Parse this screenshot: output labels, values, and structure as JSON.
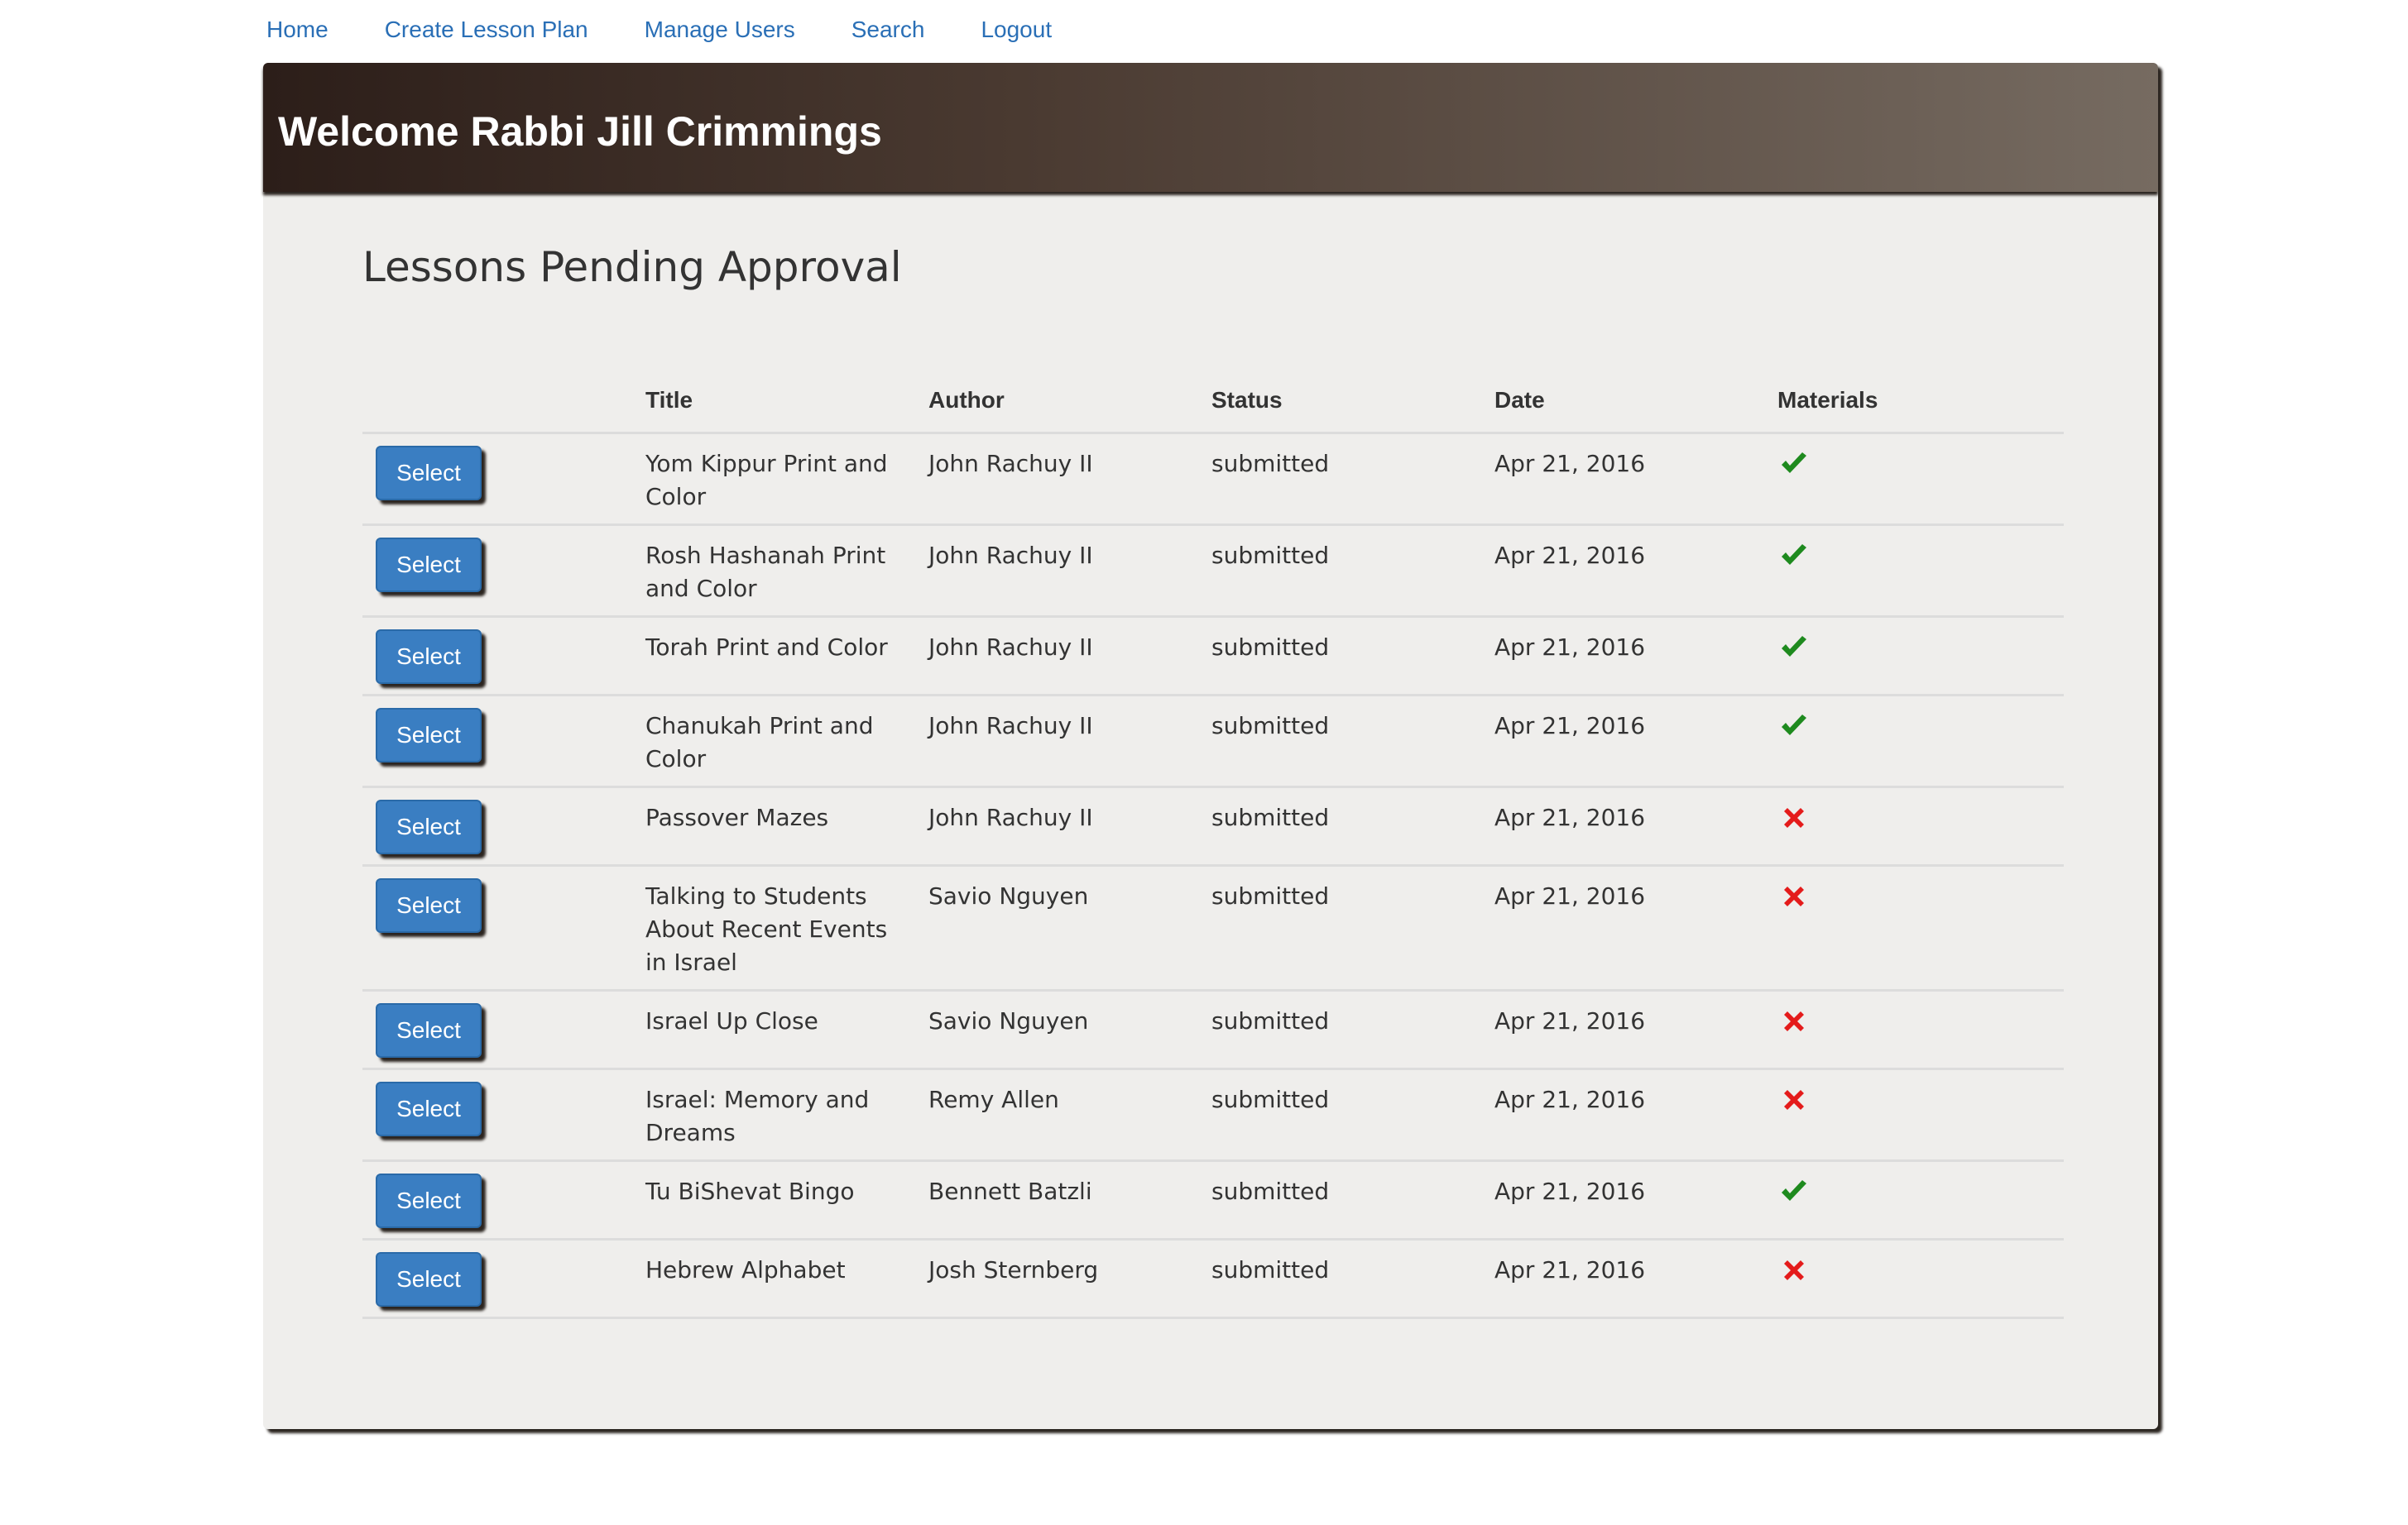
{
  "nav": {
    "items": [
      {
        "label": "Home"
      },
      {
        "label": "Create Lesson Plan"
      },
      {
        "label": "Manage Users"
      },
      {
        "label": "Search"
      },
      {
        "label": "Logout"
      }
    ]
  },
  "banner": {
    "title": "Welcome Rabbi Jill Crimmings",
    "gradient_start": "#2c1e19",
    "gradient_end": "#766b61"
  },
  "section": {
    "title": "Lessons Pending Approval"
  },
  "table": {
    "headers": [
      "",
      "Title",
      "Author",
      "Status",
      "Date",
      "Materials"
    ],
    "select_label": "Select",
    "rows": [
      {
        "title": "Yom Kippur Print and Color",
        "author": "John Rachuy II",
        "status": "submitted",
        "date": "Apr 21, 2016",
        "materials": "check-icon"
      },
      {
        "title": "Rosh Hashanah Print and Color",
        "author": "John Rachuy II",
        "status": "submitted",
        "date": "Apr 21, 2016",
        "materials": "check-icon"
      },
      {
        "title": "Torah Print and Color",
        "author": "John Rachuy II",
        "status": "submitted",
        "date": "Apr 21, 2016",
        "materials": "check-icon"
      },
      {
        "title": "Chanukah Print and Color",
        "author": "John Rachuy II",
        "status": "submitted",
        "date": "Apr 21, 2016",
        "materials": "check-icon"
      },
      {
        "title": "Passover Mazes",
        "author": "John Rachuy II",
        "status": "submitted",
        "date": "Apr 21, 2016",
        "materials": "cross-icon"
      },
      {
        "title": "Talking to Students About Recent Events in Israel",
        "author": "Savio Nguyen",
        "status": "submitted",
        "date": "Apr 21, 2016",
        "materials": "cross-icon"
      },
      {
        "title": "Israel Up Close",
        "author": "Savio Nguyen",
        "status": "submitted",
        "date": "Apr 21, 2016",
        "materials": "cross-icon"
      },
      {
        "title": "Israel: Memory and Dreams",
        "author": "Remy Allen",
        "status": "submitted",
        "date": "Apr 21, 2016",
        "materials": "cross-icon"
      },
      {
        "title": "Tu BiShevat Bingo",
        "author": "Bennett Batzli",
        "status": "submitted",
        "date": "Apr 21, 2016",
        "materials": "check-icon"
      },
      {
        "title": "Hebrew Alphabet",
        "author": "Josh Sternberg",
        "status": "submitted",
        "date": "Apr 21, 2016",
        "materials": "cross-icon"
      }
    ]
  },
  "colors": {
    "link": "#2a6fb6",
    "button": "#3a7ec2",
    "check": "#1e8a1e",
    "cross": "#e41b1b",
    "card_bg": "#efeeec"
  }
}
